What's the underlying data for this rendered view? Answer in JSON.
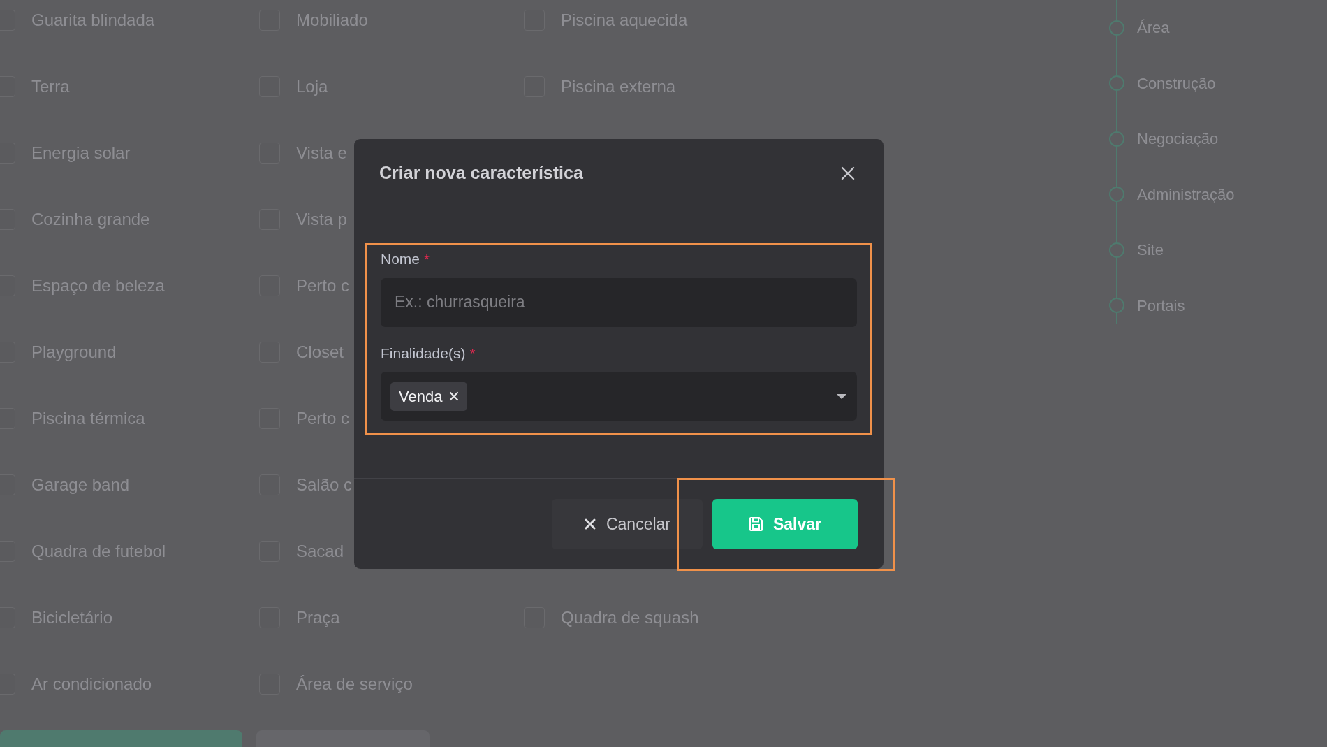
{
  "feature_rows": [
    [
      {
        "label": "Guarita blindada",
        "checked": false
      },
      {
        "label": "Mobiliado",
        "checked": false
      },
      {
        "label": "Piscina aquecida",
        "checked": false
      }
    ],
    [
      {
        "label": "Terra",
        "checked": false
      },
      {
        "label": "Loja",
        "checked": false
      },
      {
        "label": "Piscina externa",
        "checked": false
      }
    ],
    [
      {
        "label": "Energia solar",
        "checked": false
      },
      {
        "label": "Vista e",
        "checked": false
      }
    ],
    [
      {
        "label": "Cozinha grande",
        "checked": false
      },
      {
        "label": "Vista p",
        "checked": false
      }
    ],
    [
      {
        "label": "Espaço de beleza",
        "checked": false
      },
      {
        "label": "Perto c",
        "checked": false
      }
    ],
    [
      {
        "label": "Playground",
        "checked": false
      },
      {
        "label": "Closet",
        "checked": false
      }
    ],
    [
      {
        "label": "Piscina térmica",
        "checked": false
      },
      {
        "label": "Perto c",
        "checked": false
      }
    ],
    [
      {
        "label": "Garage band",
        "checked": false
      },
      {
        "label": "Salão c",
        "checked": false
      }
    ],
    [
      {
        "label": "Quadra de futebol",
        "checked": false
      },
      {
        "label": "Sacad",
        "checked": false
      }
    ],
    [
      {
        "label": "Bicicletário",
        "checked": false
      },
      {
        "label": "Praça",
        "checked": false
      },
      {
        "label": "Quadra de squash",
        "checked": false
      }
    ],
    [
      {
        "label": "Ar condicionado",
        "checked": false
      },
      {
        "label": "Área de serviço",
        "checked": false
      }
    ]
  ],
  "page_buttons": [
    {
      "kind": "primary"
    },
    {
      "kind": "secondary"
    }
  ],
  "stepper": {
    "steps": [
      {
        "label": "Área"
      },
      {
        "label": "Construção"
      },
      {
        "label": "Negociação"
      },
      {
        "label": "Administração"
      },
      {
        "label": "Site"
      },
      {
        "label": "Portais"
      }
    ]
  },
  "modal": {
    "title": "Criar nova característica",
    "form_highlighted": true,
    "fields": [
      {
        "kind": "text",
        "label": "Nome",
        "required_mark": "*",
        "placeholder": "Ex.: churrasqueira"
      },
      {
        "kind": "multiselect",
        "label": "Finalidade(s)",
        "required_mark": "*",
        "tags": [
          "Venda"
        ]
      }
    ],
    "buttons": [
      {
        "kind": "secondary",
        "label": "Cancelar",
        "highlighted": false
      },
      {
        "kind": "primary",
        "label": "Salvar",
        "highlighted": true
      }
    ]
  }
}
